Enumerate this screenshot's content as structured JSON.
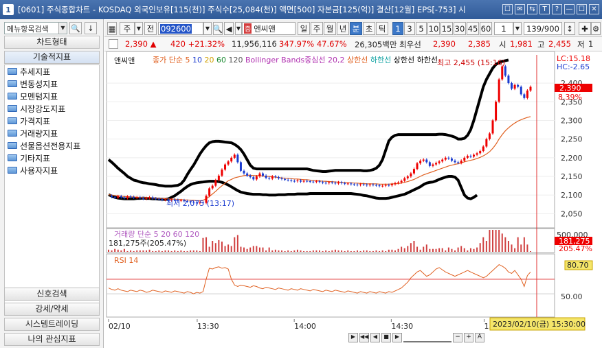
{
  "window": {
    "num": "1",
    "title": "[0601] 주식종합차트 - KOSDAQ 외국인보유[115(천)] 주식수[25,084(천)] 액면[500] 자본금[125(억)] 결산[12월] EPS[-753] 시"
  },
  "title_buttons": [
    "☐",
    "✉",
    "⇆",
    "T",
    "?",
    "—",
    "☐",
    "✕"
  ],
  "left_panel": {
    "search_label": "메뉴항목검색",
    "chart_type_header": "차트형태",
    "tech_header": "기술적지표",
    "tree": [
      "추세지표",
      "변동성지표",
      "모멘텀지표",
      "시장강도지표",
      "가격지표",
      "거래량지표",
      "선물옵션전용지표",
      "기타지표",
      "사용자지표"
    ],
    "bottom": [
      "신호검색",
      "강세/약세",
      "시스템트레이딩",
      "나의 관심지표"
    ]
  },
  "toolbar": {
    "market": "주",
    "prev": "전",
    "code": "092600",
    "name": "앤씨앤",
    "periods": [
      "일",
      "주",
      "월",
      "년",
      "분",
      "초",
      "틱"
    ],
    "active_period": "분",
    "intervals": [
      "1",
      "3",
      "5",
      "10",
      "15",
      "30",
      "45",
      "60"
    ],
    "active_interval": "1",
    "count": "1",
    "range": "139/900"
  },
  "quote": {
    "price": "2,390 ▲",
    "change": "420 +21.32%",
    "volume": "11,956,116",
    "vol_ratio": "347.97% 47.67%",
    "amount": "26,305백만 최우선",
    "bid": "2,390",
    "ask": "2,385",
    "open_label": "시",
    "open": "1,981",
    "high_label": "고",
    "high": "2,455",
    "low_label": "저",
    "low": "1"
  },
  "chart_data": {
    "type": "line",
    "title": "앤씨앤",
    "legend": [
      "종가 단순 5",
      "10",
      "20",
      "60",
      "120",
      "Bollinger Bands중심선 20,2",
      "상한선",
      "하한선",
      "상한선",
      "하한선"
    ],
    "price_ticks": [
      "2,400",
      "2,350",
      "2,300",
      "2,250",
      "2,200",
      "2,150",
      "2,100",
      "2,050"
    ],
    "ylim": [
      2025,
      2470
    ],
    "time_labels": [
      "02/10",
      "13:30",
      "14:00",
      "14:30",
      "15:00"
    ],
    "current_price": "2,390",
    "current_change": "8.39%",
    "lc_label": "LC:15.18",
    "hc_label": "HC:-2.65",
    "high_mark": "최고 2,455 (15:16)",
    "low_mark": "최저 2,075 (13:17)",
    "price_series": [
      2098,
      2095,
      2093,
      2097,
      2094,
      2092,
      2096,
      2095,
      2093,
      2094,
      2092,
      2090,
      2092,
      2094,
      2091,
      2090,
      2089,
      2087,
      2088,
      2086,
      2088,
      2087,
      2085,
      2086,
      2084,
      2083,
      2082,
      2080,
      2078,
      2080,
      2079,
      2098,
      2118,
      2125,
      2140,
      2152,
      2168,
      2182,
      2190,
      2200,
      2208,
      2188,
      2165,
      2158,
      2152,
      2148,
      2142,
      2150,
      2158,
      2152,
      2146,
      2144,
      2150,
      2148,
      2145,
      2143,
      2141,
      2140,
      2138,
      2137,
      2139,
      2136,
      2138,
      2137,
      2136,
      2135,
      2137,
      2135,
      2133,
      2132,
      2134,
      2133,
      2131,
      2134,
      2132,
      2130,
      2131,
      2129,
      2128,
      2127,
      2129,
      2128,
      2126,
      2128,
      2127,
      2126,
      2124,
      2125,
      2127,
      2126,
      2129,
      2132,
      2134,
      2138,
      2145,
      2150,
      2158,
      2170,
      2185,
      2192,
      2195,
      2188,
      2178,
      2182,
      2186,
      2190,
      2195,
      2200,
      2198,
      2192,
      2188,
      2186,
      2192,
      2200,
      2205,
      2203,
      2208,
      2212,
      2218,
      2230,
      2250,
      2265,
      2300,
      2350,
      2410,
      2445,
      2420,
      2400,
      2385,
      2395,
      2390,
      2370,
      2360,
      2380,
      2390
    ],
    "ma_series": [
      2101,
      2100,
      2099,
      2098,
      2097,
      2096,
      2096,
      2095,
      2095,
      2094,
      2094,
      2093,
      2093,
      2093,
      2092,
      2092,
      2091,
      2091,
      2090,
      2090,
      2089,
      2089,
      2088,
      2088,
      2087,
      2087,
      2086,
      2086,
      2085,
      2085,
      2086,
      2090,
      2096,
      2103,
      2110,
      2118,
      2125,
      2132,
      2138,
      2142,
      2146,
      2148,
      2150,
      2152,
      2153,
      2153,
      2152,
      2152,
      2152,
      2151,
      2150,
      2150,
      2149,
      2148,
      2147,
      2146,
      2145,
      2145,
      2144,
      2143,
      2143,
      2142,
      2141,
      2141,
      2140,
      2139,
      2139,
      2138,
      2137,
      2137,
      2136,
      2136,
      2135,
      2135,
      2134,
      2134,
      2133,
      2133,
      2132,
      2132,
      2131,
      2131,
      2130,
      2130,
      2130,
      2130,
      2129,
      2129,
      2129,
      2129,
      2130,
      2130,
      2131,
      2132,
      2134,
      2136,
      2139,
      2142,
      2146,
      2150,
      2154,
      2157,
      2160,
      2163,
      2166,
      2169,
      2172,
      2175,
      2178,
      2180,
      2182,
      2184,
      2186,
      2189,
      2191,
      2193,
      2195,
      2198,
      2201,
      2205,
      2210,
      2216,
      2225,
      2236,
      2250,
      2262,
      2272,
      2280,
      2287,
      2293,
      2298,
      2302,
      2305,
      2308,
      2310
    ],
    "bb_upper": [
      2195,
      2188,
      2180,
      2172,
      2165,
      2158,
      2150,
      2145,
      2140,
      2138,
      2135,
      2133,
      2132,
      2130,
      2129,
      2128,
      2126,
      2125,
      2124,
      2124,
      2124,
      2125,
      2126,
      2130,
      2140,
      2155,
      2168,
      2180,
      2195,
      2210,
      2222,
      2232,
      2240,
      2243,
      2244,
      2244,
      2243,
      2242,
      2241,
      2240,
      2236,
      2230,
      2222,
      2210,
      2195,
      2180,
      2172,
      2170,
      2170,
      2170,
      2170,
      2170,
      2170,
      2170,
      2170,
      2170,
      2170,
      2170,
      2170,
      2170,
      2170,
      2170,
      2170,
      2170,
      2168,
      2166,
      2165,
      2164,
      2163,
      2163,
      2164,
      2165,
      2166,
      2166,
      2166,
      2166,
      2166,
      2166,
      2166,
      2166,
      2166,
      2165,
      2165,
      2166,
      2168,
      2172,
      2180,
      2195,
      2220,
      2245,
      2255,
      2260,
      2262,
      2262,
      2262,
      2262,
      2262,
      2262,
      2262,
      2262,
      2262,
      2262,
      2262,
      2262,
      2262,
      2263,
      2263,
      2262,
      2260,
      2258,
      2255,
      2250,
      2250,
      2252,
      2260,
      2275,
      2300,
      2330,
      2360,
      2390,
      2410,
      2425,
      2440,
      2450,
      2455,
      2458,
      2460,
      2462
    ],
    "bb_lower": [
      2101,
      2097,
      2094,
      2092,
      2091,
      2090,
      2090,
      2090,
      2090,
      2091,
      2091,
      2092,
      2091,
      2091,
      2090,
      2090,
      2089,
      2089,
      2088,
      2090,
      2094,
      2098,
      2104,
      2110,
      2117,
      2123,
      2128,
      2131,
      2133,
      2134,
      2135,
      2136,
      2137,
      2137,
      2137,
      2136,
      2134,
      2131,
      2127,
      2122,
      2117,
      2112,
      2108,
      2106,
      2104,
      2103,
      2102,
      2102,
      2102,
      2101,
      2101,
      2100,
      2100,
      2100,
      2101,
      2101,
      2101,
      2102,
      2102,
      2102,
      2103,
      2103,
      2103,
      2103,
      2104,
      2104,
      2104,
      2104,
      2104,
      2104,
      2104,
      2104,
      2104,
      2104,
      2104,
      2104,
      2104,
      2104,
      2103,
      2102,
      2101,
      2099,
      2098,
      2096,
      2094,
      2092,
      2091,
      2091,
      2091,
      2092,
      2094,
      2096,
      2098,
      2100,
      2102,
      2106,
      2110,
      2114,
      2118,
      2122,
      2128,
      2132,
      2134,
      2135,
      2138,
      2142,
      2145,
      2148,
      2150,
      2150,
      2148,
      2140,
      2120,
      2100,
      2092,
      2090,
      2094,
      2100
    ],
    "volume_label": "거래량 단순 5 20 60 120",
    "volume_value": "181,275주(205.47%)",
    "volume_axis": "500,000",
    "volume_current": "181,275",
    "volume_pct": "205.47%",
    "rsi_label": "RSI 14",
    "rsi_axis": [
      "50.00"
    ],
    "rsi_value": "80.70",
    "rsi_series": [
      58,
      56,
      55,
      57,
      55,
      54,
      53,
      55,
      54,
      53,
      55,
      54,
      52,
      53,
      55,
      54,
      53,
      52,
      54,
      53,
      52,
      54,
      53,
      52,
      51,
      53,
      52,
      50,
      52,
      51,
      53,
      70,
      85,
      84,
      86,
      87,
      85,
      86,
      84,
      70,
      62,
      60,
      62,
      61,
      60,
      59,
      61,
      60,
      58,
      57,
      59,
      58,
      57,
      56,
      58,
      57,
      56,
      55,
      57,
      56,
      55,
      57,
      56,
      55,
      54,
      56,
      55,
      54,
      53,
      55,
      54,
      53,
      55,
      54,
      53,
      52,
      54,
      53,
      52,
      51,
      53,
      52,
      51,
      53,
      52,
      51,
      53,
      52,
      51,
      53,
      52,
      54,
      56,
      58,
      62,
      66,
      72,
      76,
      80,
      82,
      78,
      74,
      76,
      80,
      84,
      86,
      83,
      80,
      78,
      76,
      74,
      76,
      78,
      80,
      82,
      80,
      78,
      76,
      74,
      72,
      74,
      78,
      82,
      86,
      90,
      88,
      85,
      80,
      78,
      82,
      76,
      70,
      60,
      75,
      80
    ],
    "cursor_time": "2023/02/10(금) 15:30:00"
  }
}
